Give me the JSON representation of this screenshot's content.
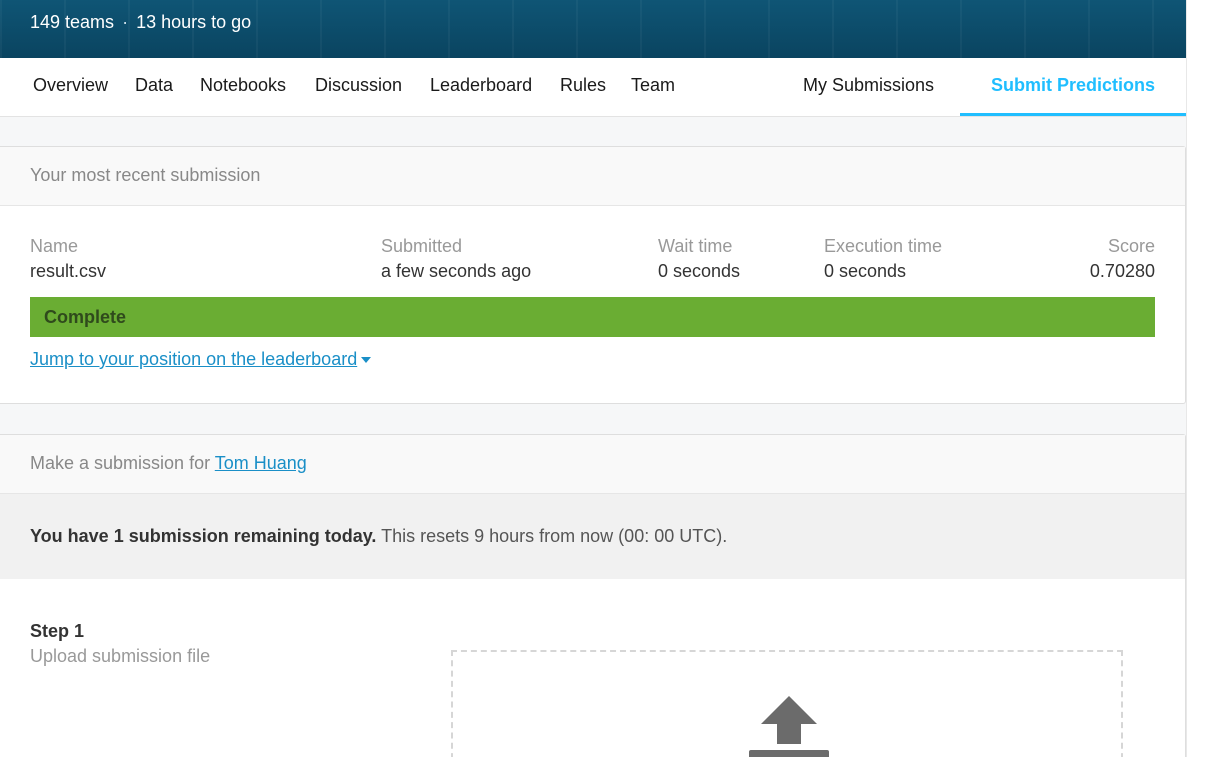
{
  "banner": {
    "teams": "149 teams",
    "separator": "·",
    "time_left": "13 hours to go"
  },
  "tabs": {
    "left": [
      "Overview",
      "Data",
      "Notebooks",
      "Discussion",
      "Leaderboard",
      "Rules",
      "Team"
    ],
    "my_submissions": "My Submissions",
    "submit_predictions": "Submit Predictions",
    "active": "Submit Predictions"
  },
  "recent": {
    "heading": "Your most recent submission",
    "columns": {
      "name": "Name",
      "submitted": "Submitted",
      "wait": "Wait time",
      "exec": "Execution time",
      "score": "Score"
    },
    "values": {
      "name": "result.csv",
      "submitted": "a few seconds ago",
      "wait": "0 seconds",
      "exec": "0 seconds",
      "score": "0.70280"
    },
    "status": "Complete",
    "jump_link": "Jump to your position on the leaderboard"
  },
  "make": {
    "heading_prefix": "Make a submission for",
    "user": "Tom Huang",
    "notice_bold": "You have 1 submission remaining today.",
    "notice_rest": " This resets 9 hours from now (00: 00 UTC).",
    "step_title": "Step 1",
    "step_sub": "Upload submission file",
    "upload_icon": "upload-icon"
  },
  "colors": {
    "accent": "#20beff",
    "status_green": "#6aad33",
    "banner": "#0d4b68",
    "link": "#1a8fc7"
  }
}
